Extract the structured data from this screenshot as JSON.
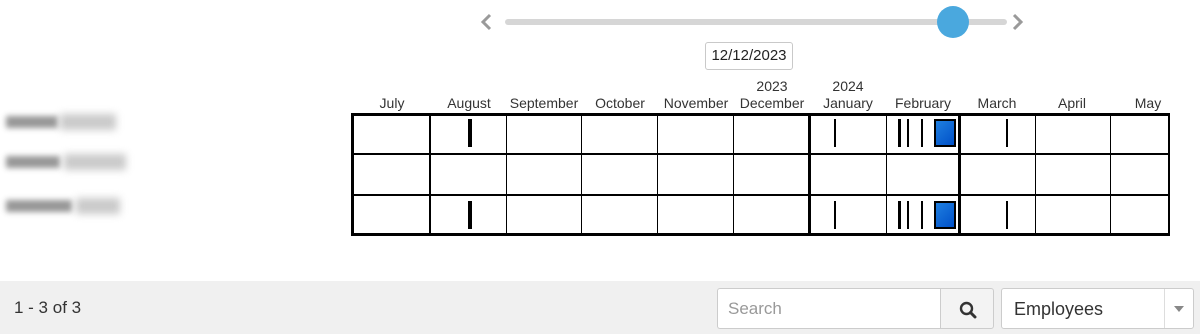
{
  "slider": {
    "date_label": "12/12/2023",
    "position": 0.92,
    "prev_icon": "chevron-left-icon",
    "next_icon": "chevron-right-icon",
    "track_color": "#d6d6d6",
    "handle_color": "#4aa8de"
  },
  "months": [
    {
      "year": "",
      "label": "July"
    },
    {
      "year": "",
      "label": "August"
    },
    {
      "year": "",
      "label": "September"
    },
    {
      "year": "",
      "label": "October"
    },
    {
      "year": "",
      "label": "November"
    },
    {
      "year": "2023",
      "label": "December"
    },
    {
      "year": "2024",
      "label": "January"
    },
    {
      "year": "",
      "label": "February"
    },
    {
      "year": "",
      "label": "March"
    },
    {
      "year": "",
      "label": "April"
    },
    {
      "year": "",
      "label": "May"
    }
  ],
  "employees": [
    {
      "name_redacted": true
    },
    {
      "name_redacted": true
    },
    {
      "name_redacted": true
    }
  ],
  "footer": {
    "range_text": "1 - 3 of 3",
    "search_placeholder": "Search",
    "search_value": "",
    "search_icon": "search-icon",
    "select_value": "Employees",
    "select_icon": "chevron-down-icon",
    "event_color": "#1f7fe0"
  }
}
